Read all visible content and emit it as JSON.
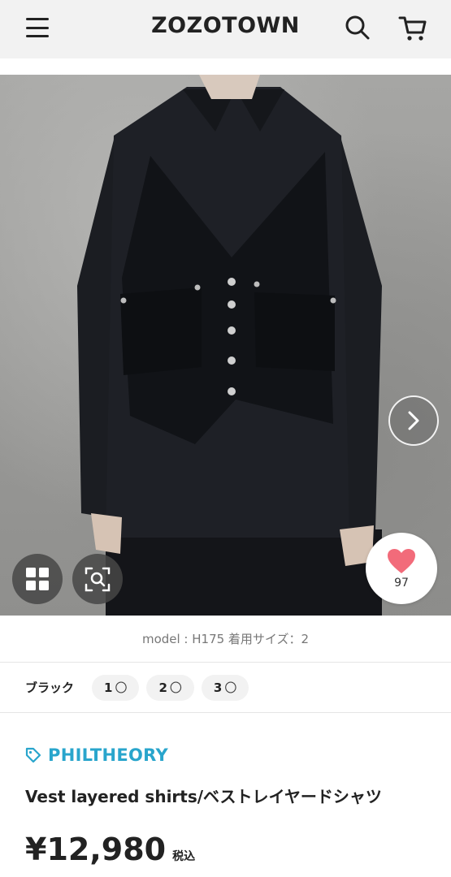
{
  "header": {
    "logo": "ZOZOTOWN",
    "menu_icon": "hamburger-menu-icon",
    "search_icon": "search-icon",
    "cart_icon": "cart-icon"
  },
  "gallery": {
    "next_icon": "chevron-right-icon",
    "grid_icon": "grid-view-icon",
    "zoom_icon": "zoom-search-icon",
    "favorite_icon": "heart-icon",
    "favorite_count": "97",
    "favorite_color": "#f26b7a"
  },
  "model_info": "model : H175 着用サイズ：2",
  "variants": {
    "color": "ブラック",
    "sizes": [
      {
        "label": "1",
        "stock": "〇"
      },
      {
        "label": "2",
        "stock": "〇"
      },
      {
        "label": "3",
        "stock": "〇"
      }
    ]
  },
  "product": {
    "brand": "PHILTHEORY",
    "brand_icon": "tag-icon",
    "brand_color": "#29a5cc",
    "title": "Vest layered shirts/ベストレイヤードシャツ",
    "price": "¥12,980",
    "tax_label": "税込"
  }
}
